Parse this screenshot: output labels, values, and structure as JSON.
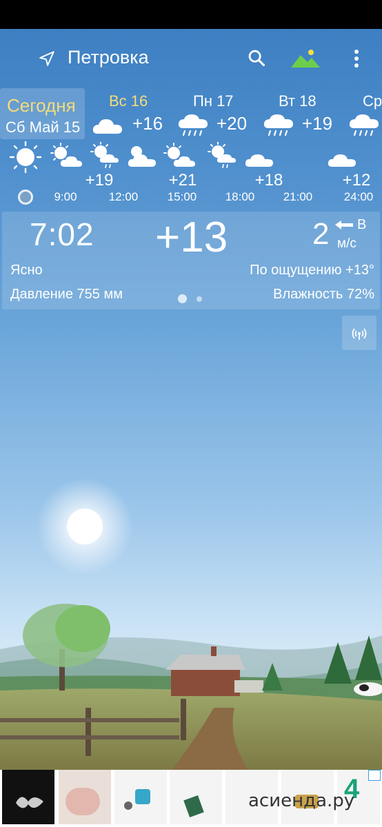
{
  "header": {
    "city": "Петровка"
  },
  "today": {
    "label": "Сегодня",
    "date": "Сб Май 15"
  },
  "days": [
    {
      "name": "Вс 16",
      "temp": "+16",
      "icon": "cloud-icon",
      "weekend": true
    },
    {
      "name": "Пн 17",
      "temp": "+20",
      "icon": "rain-cloud-icon",
      "weekend": false
    },
    {
      "name": "Вт 18",
      "temp": "+19",
      "icon": "rain-cloud-icon",
      "weekend": false
    },
    {
      "name": "Ср",
      "temp": "",
      "icon": "rain-cloud-icon",
      "weekend": false
    }
  ],
  "hourly": [
    {
      "time": "9:00",
      "temp": "+19",
      "icon": "sun-cloud-icon"
    },
    {
      "time": "12:00",
      "temp": "",
      "icon": "sun-rain-icon"
    },
    {
      "time": "15:00",
      "temp": "+21",
      "icon": "sun-cloud-icon"
    },
    {
      "time": "18:00",
      "temp": "",
      "icon": "sun-rain-icon"
    },
    {
      "time": "21:00",
      "temp": "+18",
      "icon": "cloud-icon"
    },
    {
      "time": "24:00",
      "temp": "+12",
      "icon": "cloud-icon"
    }
  ],
  "current": {
    "time": "7:02",
    "temp": "+13",
    "wind_speed": "2",
    "wind_dir": "В",
    "wind_unit": "м/с",
    "condition": "Ясно",
    "feels_like": "По ощущению +13°",
    "pressure": "Давление 755 мм",
    "humidity": "Влажность 72%"
  },
  "ad": {
    "brand": "асиенда.ру"
  },
  "colors": {
    "today_accent": "#f5dc79",
    "sky_top": "#3d7fc2",
    "sky_bottom": "#d8eaf6"
  }
}
